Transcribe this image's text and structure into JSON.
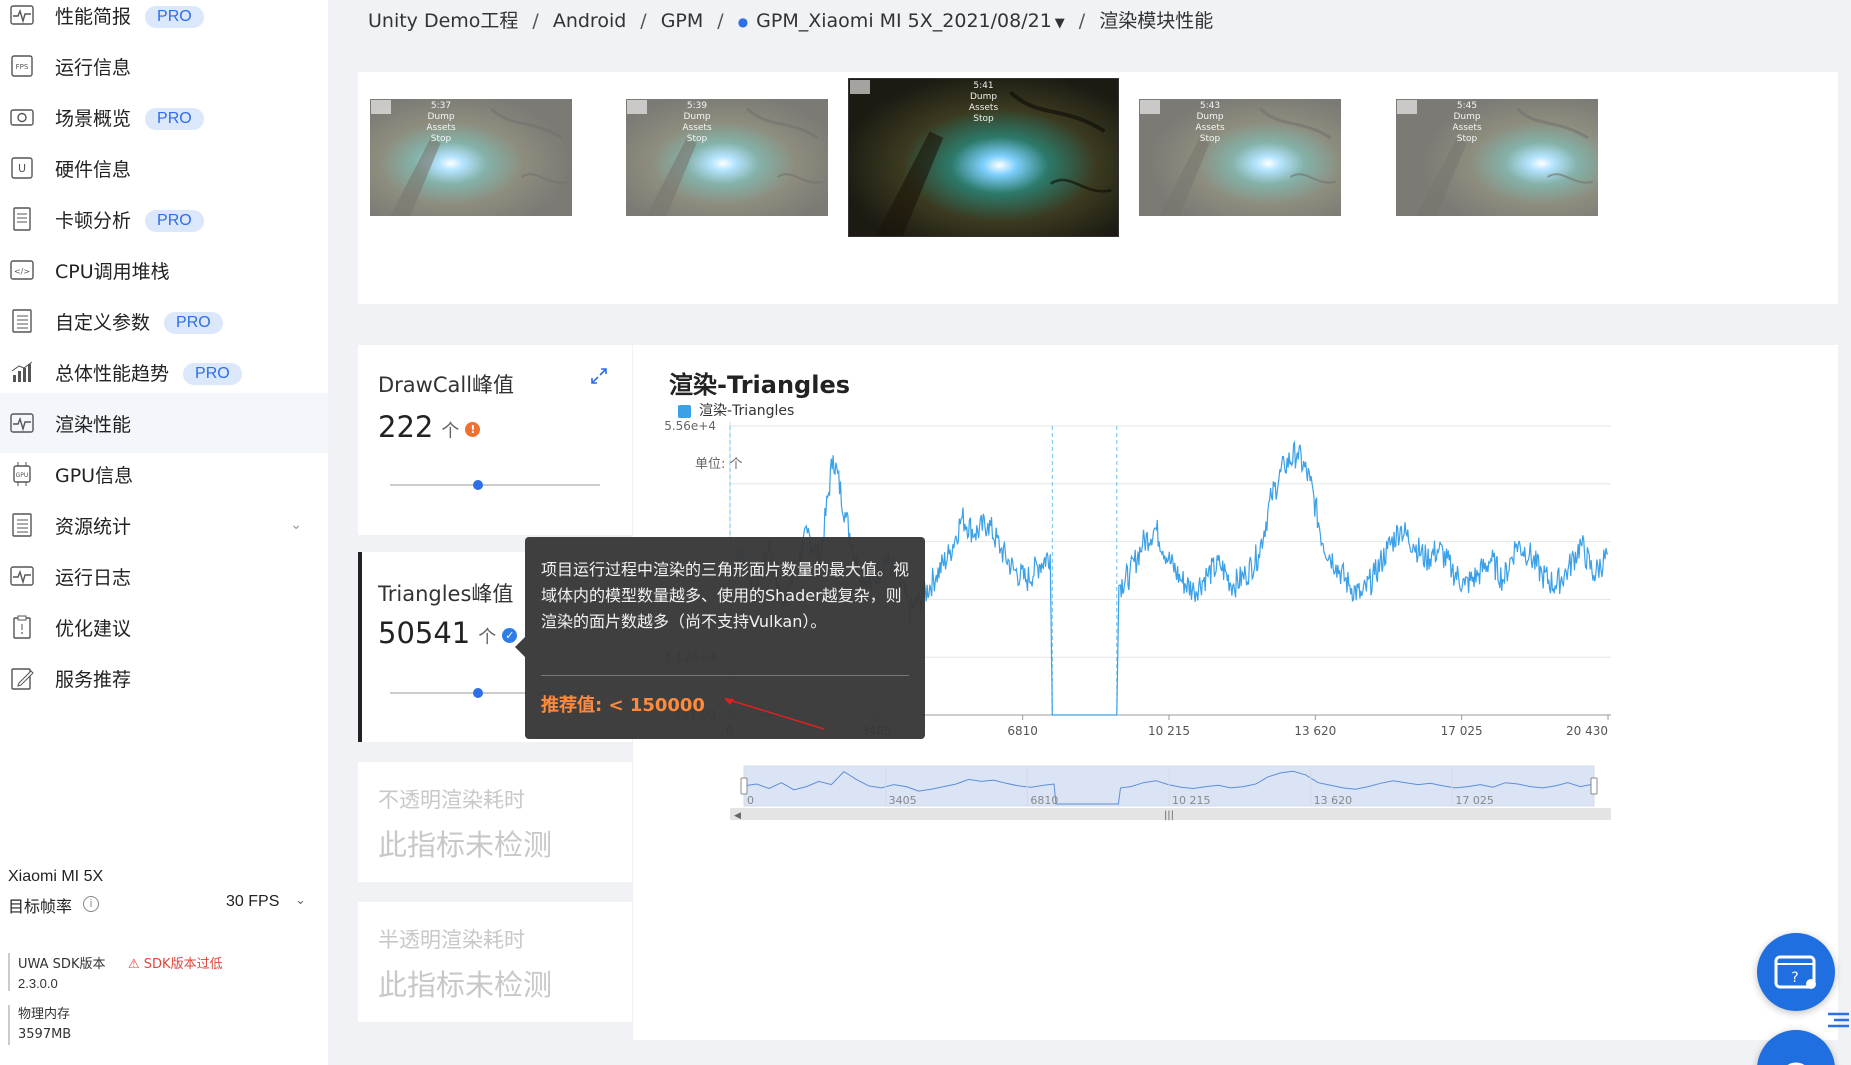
{
  "sidebar": {
    "items": [
      {
        "name": "perf-summary",
        "label": "性能简报",
        "pro": true,
        "icon": "pulse-icon"
      },
      {
        "name": "runtime-info",
        "label": "运行信息",
        "pro": false,
        "icon": "fps-icon"
      },
      {
        "name": "scene-overview",
        "label": "场景概览",
        "pro": true,
        "icon": "camera-icon"
      },
      {
        "name": "hardware-info",
        "label": "硬件信息",
        "pro": false,
        "icon": "u-chip-icon"
      },
      {
        "name": "jank-analysis",
        "label": "卡顿分析",
        "pro": true,
        "icon": "document-icon"
      },
      {
        "name": "cpu-callstack",
        "label": "CPU调用堆栈",
        "pro": false,
        "icon": "code-icon"
      },
      {
        "name": "custom-params",
        "label": "自定义参数",
        "pro": true,
        "icon": "list-icon"
      },
      {
        "name": "overall-trend",
        "label": "总体性能趋势",
        "pro": true,
        "icon": "bar-trend-icon"
      },
      {
        "name": "render-perf",
        "label": "渲染性能",
        "pro": false,
        "icon": "pulse-icon",
        "active": true
      },
      {
        "name": "gpu-info",
        "label": "GPU信息",
        "pro": false,
        "icon": "gpu-chip-icon"
      },
      {
        "name": "resource-stats",
        "label": "资源统计",
        "pro": false,
        "icon": "list-icon",
        "expandable": true
      },
      {
        "name": "runtime-log",
        "label": "运行日志",
        "pro": false,
        "icon": "pulse-icon"
      },
      {
        "name": "optimization",
        "label": "优化建议",
        "pro": false,
        "icon": "clipboard-icon"
      },
      {
        "name": "service-rec",
        "label": "服务推荐",
        "pro": false,
        "icon": "edit-icon"
      }
    ],
    "pro_label": "PRO",
    "device_name": "Xiaomi MI 5X",
    "target_fps_label": "目标帧率",
    "target_fps_value": "30 FPS",
    "sdk_label": "UWA SDK版本",
    "sdk_warning": "SDK版本过低",
    "sdk_version": "2.3.0.0",
    "memory_label": "物理内存",
    "memory_value": "3597MB"
  },
  "breadcrumb": {
    "items": [
      "Unity Demo工程",
      "Android",
      "GPM",
      "GPM_Xiaomi MI 5X_2021/08/21",
      "渲染模块性能"
    ],
    "separator": "/"
  },
  "thumbnails": {
    "overlay_time": [
      "5:37",
      "5:39",
      "5:41",
      "5:43",
      "5:45"
    ],
    "overlay_buttons": [
      "Dump",
      "Assets",
      "Stop"
    ],
    "selected_index": 2
  },
  "metrics": {
    "drawcall": {
      "title": "DrawCall峰值",
      "value": "222",
      "unit": "个",
      "status": "warning",
      "slider": 0.42
    },
    "triangles": {
      "title": "Triangles峰值",
      "value": "50541",
      "unit": "个",
      "status": "ok",
      "slider": 0.42
    },
    "opaque": {
      "title": "不透明渲染耗时",
      "na": "此指标未检测"
    },
    "transparent": {
      "title": "半透明渲染耗时",
      "na": "此指标未检测"
    }
  },
  "tooltip": {
    "text": "项目运行过程中渲染的三角形面片数量的最大值。视域体内的模型数量越多、使用的Shader越复杂，则渲染的面片数越多（尚不支持Vulkan）。",
    "recommend": "推荐值: < 150000"
  },
  "chart_data": {
    "type": "line",
    "title": "渲染-Triangles",
    "unit_label": "单位: 个",
    "series": [
      {
        "name": "渲染-Triangles",
        "color": "#3aa0e8"
      }
    ],
    "y_ticks": [
      "137.00",
      "1.12e+4",
      "5.56e+4"
    ],
    "ylim": [
      137,
      55600
    ],
    "x_ticks": [
      "0",
      "3405",
      "6810",
      "10 215",
      "13 620",
      "17 025",
      "20 430"
    ],
    "xlim": [
      0,
      20430
    ],
    "markers": [
      7500,
      9000
    ],
    "zoom_ticks": [
      "0",
      "3405",
      "6810",
      "10 215",
      "13 620",
      "17 025"
    ],
    "points": [
      [
        0,
        28000
      ],
      [
        300,
        31000
      ],
      [
        600,
        24000
      ],
      [
        900,
        33000
      ],
      [
        1200,
        22000
      ],
      [
        1500,
        27000
      ],
      [
        1800,
        35000
      ],
      [
        2100,
        30000
      ],
      [
        2400,
        50000
      ],
      [
        2700,
        38000
      ],
      [
        3000,
        28000
      ],
      [
        3300,
        25000
      ],
      [
        3600,
        30000
      ],
      [
        3900,
        27000
      ],
      [
        4200,
        20000
      ],
      [
        4500,
        23000
      ],
      [
        4800,
        27000
      ],
      [
        5100,
        31000
      ],
      [
        5400,
        38000
      ],
      [
        5700,
        35000
      ],
      [
        6000,
        37000
      ],
      [
        6300,
        32000
      ],
      [
        6600,
        28000
      ],
      [
        6900,
        26000
      ],
      [
        7200,
        29000
      ],
      [
        7450,
        31000
      ],
      [
        7500,
        137
      ],
      [
        9000,
        137
      ],
      [
        9050,
        25000
      ],
      [
        9300,
        27000
      ],
      [
        9600,
        33000
      ],
      [
        9900,
        36000
      ],
      [
        10200,
        30000
      ],
      [
        10500,
        26000
      ],
      [
        10800,
        24000
      ],
      [
        11100,
        27000
      ],
      [
        11400,
        29000
      ],
      [
        11700,
        25000
      ],
      [
        12000,
        27000
      ],
      [
        12300,
        31000
      ],
      [
        12600,
        42000
      ],
      [
        12900,
        48000
      ],
      [
        13200,
        50541
      ],
      [
        13500,
        45000
      ],
      [
        13800,
        33000
      ],
      [
        14100,
        29000
      ],
      [
        14400,
        25000
      ],
      [
        14700,
        23000
      ],
      [
        15000,
        27000
      ],
      [
        15300,
        32000
      ],
      [
        15600,
        36000
      ],
      [
        15900,
        33000
      ],
      [
        16200,
        30000
      ],
      [
        16500,
        32000
      ],
      [
        16800,
        28000
      ],
      [
        17100,
        25000
      ],
      [
        17400,
        27000
      ],
      [
        17700,
        30000
      ],
      [
        18000,
        26000
      ],
      [
        18300,
        33000
      ],
      [
        18600,
        31000
      ],
      [
        18900,
        27000
      ],
      [
        19200,
        25000
      ],
      [
        19500,
        28000
      ],
      [
        19800,
        33000
      ],
      [
        20100,
        27000
      ],
      [
        20430,
        31000
      ]
    ]
  },
  "colors": {
    "accent": "#2e6ee6",
    "series": "#3aa0e8",
    "warning": "#f07030",
    "warn_text": "#e0453a",
    "recommend": "#ff8a3c"
  }
}
